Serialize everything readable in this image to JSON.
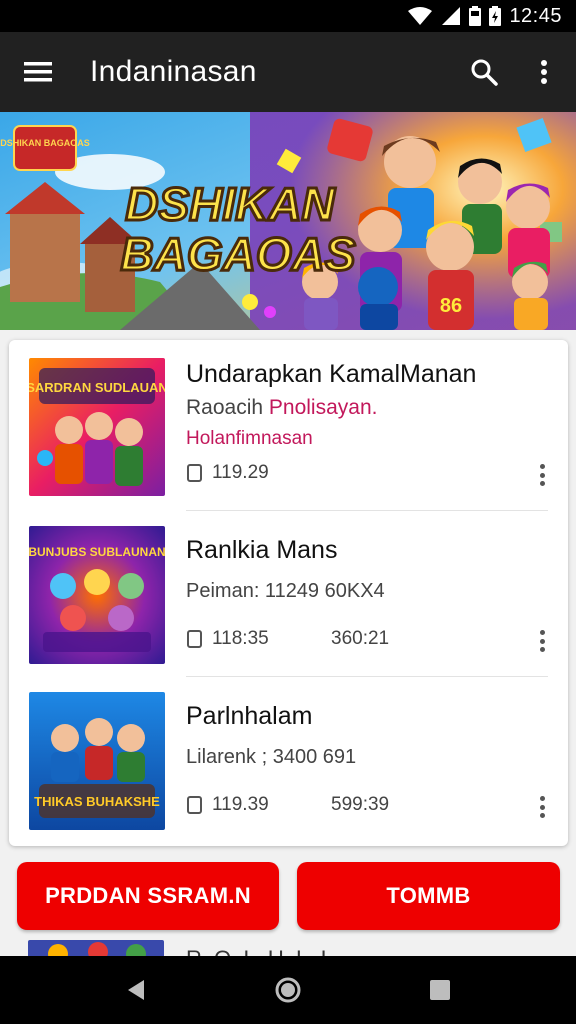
{
  "status_bar": {
    "time": "12:45",
    "icons": [
      "wifi-icon",
      "signal-icon",
      "battery-icon",
      "battery-icon"
    ]
  },
  "app_bar": {
    "title": "Indaninasan",
    "menu_icon": "menu-icon",
    "search_icon": "search-icon",
    "more_icon": "more-vert-icon"
  },
  "banner": {
    "line1": "DSHIKAN",
    "line2": "BAGAOAS",
    "sign_text": "DSHIKAN BAGAOAS"
  },
  "list": {
    "items": [
      {
        "thumb_text": "SARDRAN SUDLAUAN",
        "title": "Undarapkan KamalManan",
        "subtitle": "Raoacih",
        "subtitle_accent": "Pnolisayan.",
        "extra": "Holanfimnasan",
        "meta": "119.29",
        "meta2": ""
      },
      {
        "thumb_text": "BUNJUBS SUBLAUNAN",
        "title": "Ranlkia Mans",
        "subtitle": "Peiman: 11249 60KX4",
        "meta": "118:35",
        "meta2": "360:21"
      },
      {
        "thumb_text": "THIKAS BUHAKSHE",
        "title": "Parlnhalam",
        "subtitle": "Lilarenk ; 3400 691",
        "meta": "119.39",
        "meta2": "599:39"
      }
    ]
  },
  "buttons": {
    "primary": "PRDDAN SSRAM.N",
    "secondary": "TOMMB"
  },
  "peek_item": {
    "title": "R. O. L. U.  L. I."
  },
  "nav_bar": {
    "back": "back-icon",
    "home": "home-icon",
    "recents": "recents-icon"
  },
  "colors": {
    "accent_red": "#ee0000",
    "app_bar": "#212121",
    "accent_pink": "#c2185b"
  }
}
